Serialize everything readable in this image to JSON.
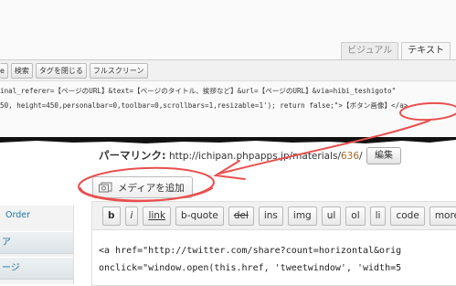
{
  "top_editor": {
    "tabs": [
      "ビジュアル",
      "テキスト"
    ],
    "toolbar_buttons": [
      "e",
      "検索",
      "タグを閉じる",
      "フルスクリーン"
    ],
    "code_lines": [
      "inal_referer=【ページのURL】&text=【ページのタイトル、挨拶など】&url=【ページのURL】&via=hibi_teshigoto\"",
      "50, height=450,personalbar=0,toolbar=0,scrollbars=1,resizable=1'); return false;\">【ボタン画像】</a>"
    ]
  },
  "permalink": {
    "label": "パーマリンク:",
    "url_prefix": "http://ichipan.phpapps.jp/materials/",
    "url_slug": "636",
    "url_suffix": "/",
    "edit_button": "編集"
  },
  "media_button": {
    "label": "メディアを追加",
    "icon": "media-icon"
  },
  "sidebar": {
    "item_order": "Order",
    "nav_items": [
      "ア",
      "ージ"
    ]
  },
  "editor_toolbar": {
    "buttons": [
      "b",
      "i",
      "link",
      "b-quote",
      "del",
      "ins",
      "img",
      "ul",
      "ol",
      "li",
      "code",
      "more"
    ]
  },
  "editor_code": [
    "<a href=\"http://twitter.com/share?count=horizontal&orig",
    "onclick=\"window.open(this.href, 'tweetwindow', 'width=5"
  ],
  "colors": {
    "annotation": "#e8504f",
    "link": "#21759b"
  }
}
